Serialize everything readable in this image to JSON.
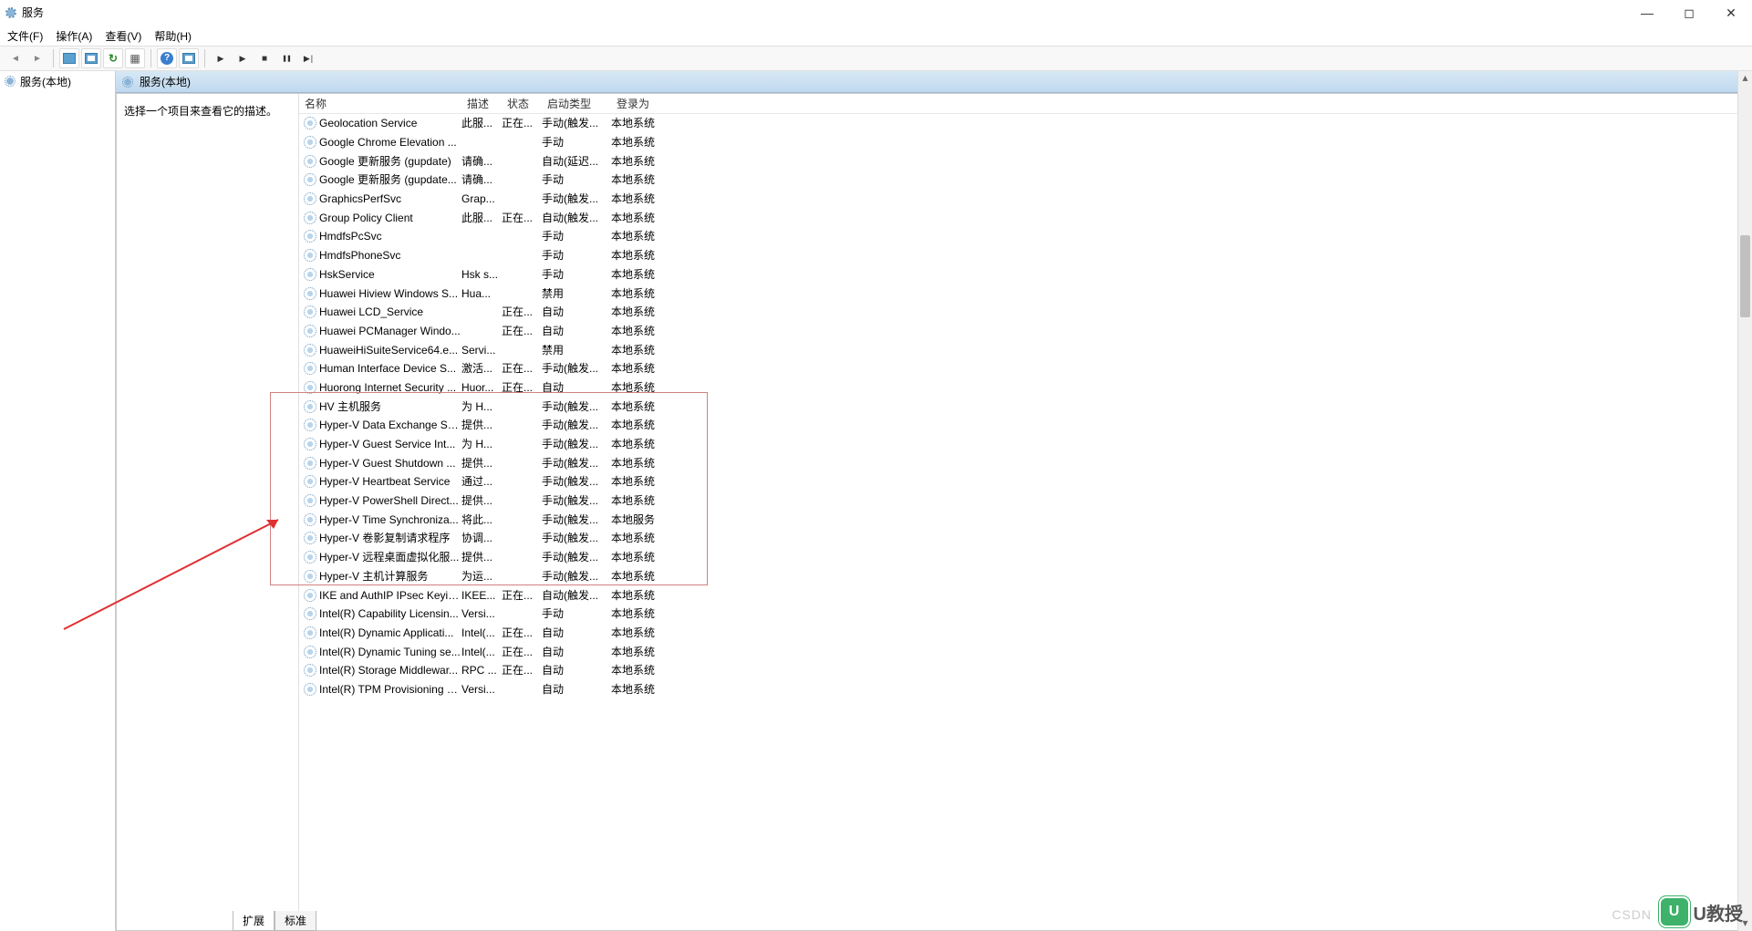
{
  "window": {
    "title": "服务"
  },
  "menubar": [
    "文件(F)",
    "操作(A)",
    "查看(V)",
    "帮助(H)"
  ],
  "tree": {
    "root": "服务(本地)"
  },
  "pane": {
    "header": "服务(本地)",
    "hint": "选择一个项目来查看它的描述。"
  },
  "columns": {
    "name": "名称",
    "desc": "描述",
    "status": "状态",
    "startup": "启动类型",
    "logon": "登录为"
  },
  "tabs": {
    "extended": "扩展",
    "standard": "标准"
  },
  "watermark": {
    "csdn": "CSDN",
    "logo": "U",
    "brand": "U教授"
  },
  "services": [
    {
      "name": "Geolocation Service",
      "desc": "此服...",
      "status": "正在...",
      "startup": "手动(触发...",
      "logon": "本地系统"
    },
    {
      "name": "Google Chrome Elevation ...",
      "desc": "",
      "status": "",
      "startup": "手动",
      "logon": "本地系统"
    },
    {
      "name": "Google 更新服务 (gupdate)",
      "desc": "请确...",
      "status": "",
      "startup": "自动(延迟...",
      "logon": "本地系统"
    },
    {
      "name": "Google 更新服务 (gupdate...",
      "desc": "请确...",
      "status": "",
      "startup": "手动",
      "logon": "本地系统"
    },
    {
      "name": "GraphicsPerfSvc",
      "desc": "Grap...",
      "status": "",
      "startup": "手动(触发...",
      "logon": "本地系统"
    },
    {
      "name": "Group Policy Client",
      "desc": "此服...",
      "status": "正在...",
      "startup": "自动(触发...",
      "logon": "本地系统"
    },
    {
      "name": "HmdfsPcSvc",
      "desc": "",
      "status": "",
      "startup": "手动",
      "logon": "本地系统"
    },
    {
      "name": "HmdfsPhoneSvc",
      "desc": "",
      "status": "",
      "startup": "手动",
      "logon": "本地系统"
    },
    {
      "name": "HskService",
      "desc": "Hsk s...",
      "status": "",
      "startup": "手动",
      "logon": "本地系统"
    },
    {
      "name": "Huawei Hiview Windows S...",
      "desc": "Hua...",
      "status": "",
      "startup": "禁用",
      "logon": "本地系统"
    },
    {
      "name": "Huawei LCD_Service",
      "desc": "",
      "status": "正在...",
      "startup": "自动",
      "logon": "本地系统"
    },
    {
      "name": "Huawei PCManager Windo...",
      "desc": "",
      "status": "正在...",
      "startup": "自动",
      "logon": "本地系统"
    },
    {
      "name": "HuaweiHiSuiteService64.e...",
      "desc": "Servi...",
      "status": "",
      "startup": "禁用",
      "logon": "本地系统"
    },
    {
      "name": "Human Interface Device S...",
      "desc": "激活...",
      "status": "正在...",
      "startup": "手动(触发...",
      "logon": "本地系统"
    },
    {
      "name": "Huorong Internet Security ...",
      "desc": "Huor...",
      "status": "正在...",
      "startup": "自动",
      "logon": "本地系统"
    },
    {
      "name": "HV 主机服务",
      "desc": "为 H...",
      "status": "",
      "startup": "手动(触发...",
      "logon": "本地系统"
    },
    {
      "name": "Hyper-V Data Exchange Se...",
      "desc": "提供...",
      "status": "",
      "startup": "手动(触发...",
      "logon": "本地系统"
    },
    {
      "name": "Hyper-V Guest Service Int...",
      "desc": "为 H...",
      "status": "",
      "startup": "手动(触发...",
      "logon": "本地系统"
    },
    {
      "name": "Hyper-V Guest Shutdown ...",
      "desc": "提供...",
      "status": "",
      "startup": "手动(触发...",
      "logon": "本地系统"
    },
    {
      "name": "Hyper-V Heartbeat Service",
      "desc": "通过...",
      "status": "",
      "startup": "手动(触发...",
      "logon": "本地系统"
    },
    {
      "name": "Hyper-V PowerShell Direct...",
      "desc": "提供...",
      "status": "",
      "startup": "手动(触发...",
      "logon": "本地系统"
    },
    {
      "name": "Hyper-V Time Synchroniza...",
      "desc": "将此...",
      "status": "",
      "startup": "手动(触发...",
      "logon": "本地服务"
    },
    {
      "name": "Hyper-V 卷影复制请求程序",
      "desc": "协调...",
      "status": "",
      "startup": "手动(触发...",
      "logon": "本地系统"
    },
    {
      "name": "Hyper-V 远程桌面虚拟化服...",
      "desc": "提供...",
      "status": "",
      "startup": "手动(触发...",
      "logon": "本地系统"
    },
    {
      "name": "Hyper-V 主机计算服务",
      "desc": "为运...",
      "status": "",
      "startup": "手动(触发...",
      "logon": "本地系统"
    },
    {
      "name": "IKE and AuthIP IPsec Keyin...",
      "desc": "IKEE...",
      "status": "正在...",
      "startup": "自动(触发...",
      "logon": "本地系统"
    },
    {
      "name": "Intel(R) Capability Licensin...",
      "desc": "Versi...",
      "status": "",
      "startup": "手动",
      "logon": "本地系统"
    },
    {
      "name": "Intel(R) Dynamic Applicati...",
      "desc": "Intel(...",
      "status": "正在...",
      "startup": "自动",
      "logon": "本地系统"
    },
    {
      "name": "Intel(R) Dynamic Tuning se...",
      "desc": "Intel(...",
      "status": "正在...",
      "startup": "自动",
      "logon": "本地系统"
    },
    {
      "name": "Intel(R) Storage Middlewar...",
      "desc": "RPC ...",
      "status": "正在...",
      "startup": "自动",
      "logon": "本地系统"
    },
    {
      "name": "Intel(R) TPM Provisioning S...",
      "desc": "Versi...",
      "status": "",
      "startup": "自动",
      "logon": "本地系统"
    }
  ]
}
